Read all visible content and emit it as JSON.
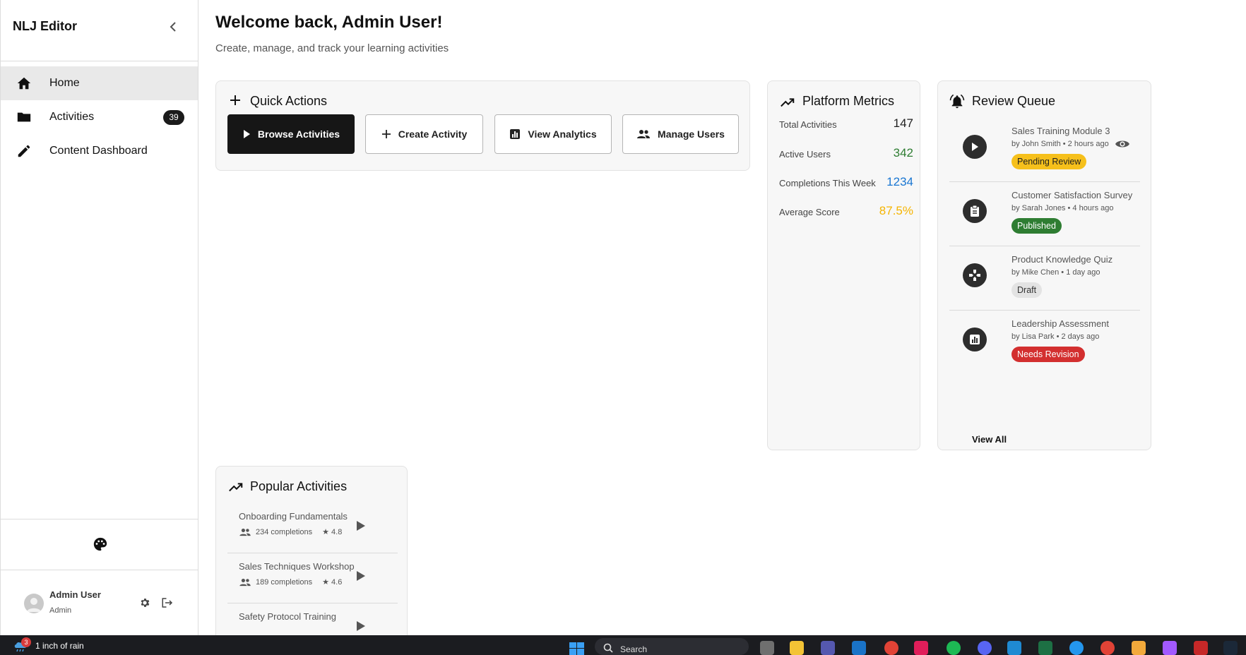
{
  "sidebar": {
    "title": "NLJ Editor",
    "nav": [
      {
        "label": "Home",
        "icon": "home-icon",
        "active": true
      },
      {
        "label": "Activities",
        "icon": "folder-icon",
        "badge": "39"
      },
      {
        "label": "Content Dashboard",
        "icon": "pencil-icon"
      }
    ],
    "user": {
      "name": "Admin User",
      "role": "Admin"
    }
  },
  "header": {
    "welcome": "Welcome back, Admin User!",
    "subtitle": "Create, manage, and track your learning activities"
  },
  "quick_actions": {
    "title": "Quick Actions",
    "buttons": [
      {
        "label": "Browse Activities",
        "icon": "play-icon"
      },
      {
        "label": "Create Activity",
        "icon": "plus-icon"
      },
      {
        "label": "View Analytics",
        "icon": "analytics-icon"
      },
      {
        "label": "Manage Users",
        "icon": "people-icon"
      }
    ]
  },
  "metrics": {
    "title": "Platform Metrics",
    "items": [
      {
        "label": "Total Activities",
        "value": "147",
        "color": "#1f1f1f"
      },
      {
        "label": "Active Users",
        "value": "342",
        "color": "#2e7d32"
      },
      {
        "label": "Completions This Week",
        "value": "1234",
        "color": "#1976d2"
      },
      {
        "label": "Average Score",
        "value": "87.5%",
        "color": "#f5b400"
      }
    ]
  },
  "review_queue": {
    "title": "Review Queue",
    "items": [
      {
        "title": "Sales Training Module 3",
        "meta": "by John Smith • 2 hours ago",
        "status": "Pending Review",
        "icon": "play-circle-icon",
        "badge_bg": "#f6c01b",
        "badge_fg": "#1f1f1f"
      },
      {
        "title": "Customer Satisfaction Survey",
        "meta": "by Sarah Jones • 4 hours ago",
        "status": "Published",
        "icon": "clipboard-icon",
        "badge_bg": "#2e7d32",
        "badge_fg": "#ffffff"
      },
      {
        "title": "Product Knowledge Quiz",
        "meta": "by Mike Chen • 1 day ago",
        "status": "Draft",
        "icon": "gamepad-icon",
        "badge_bg": "#e3e3e3",
        "badge_fg": "#333333"
      },
      {
        "title": "Leadership Assessment",
        "meta": "by Lisa Park • 2 days ago",
        "status": "Needs Revision",
        "icon": "chart-icon",
        "badge_bg": "#d32f2f",
        "badge_fg": "#ffffff"
      }
    ],
    "view_all": "View All"
  },
  "popular": {
    "title": "Popular Activities",
    "items": [
      {
        "title": "Onboarding Fundamentals",
        "completions": "234 completions",
        "rating": "★ 4.8"
      },
      {
        "title": "Sales Techniques Workshop",
        "completions": "189 completions",
        "rating": "★ 4.6"
      },
      {
        "title": "Safety Protocol Training",
        "completions": "",
        "rating": ""
      }
    ]
  },
  "taskbar": {
    "weather_badge": "3",
    "weather_text": "1 inch of rain",
    "search_placeholder": "Search"
  }
}
